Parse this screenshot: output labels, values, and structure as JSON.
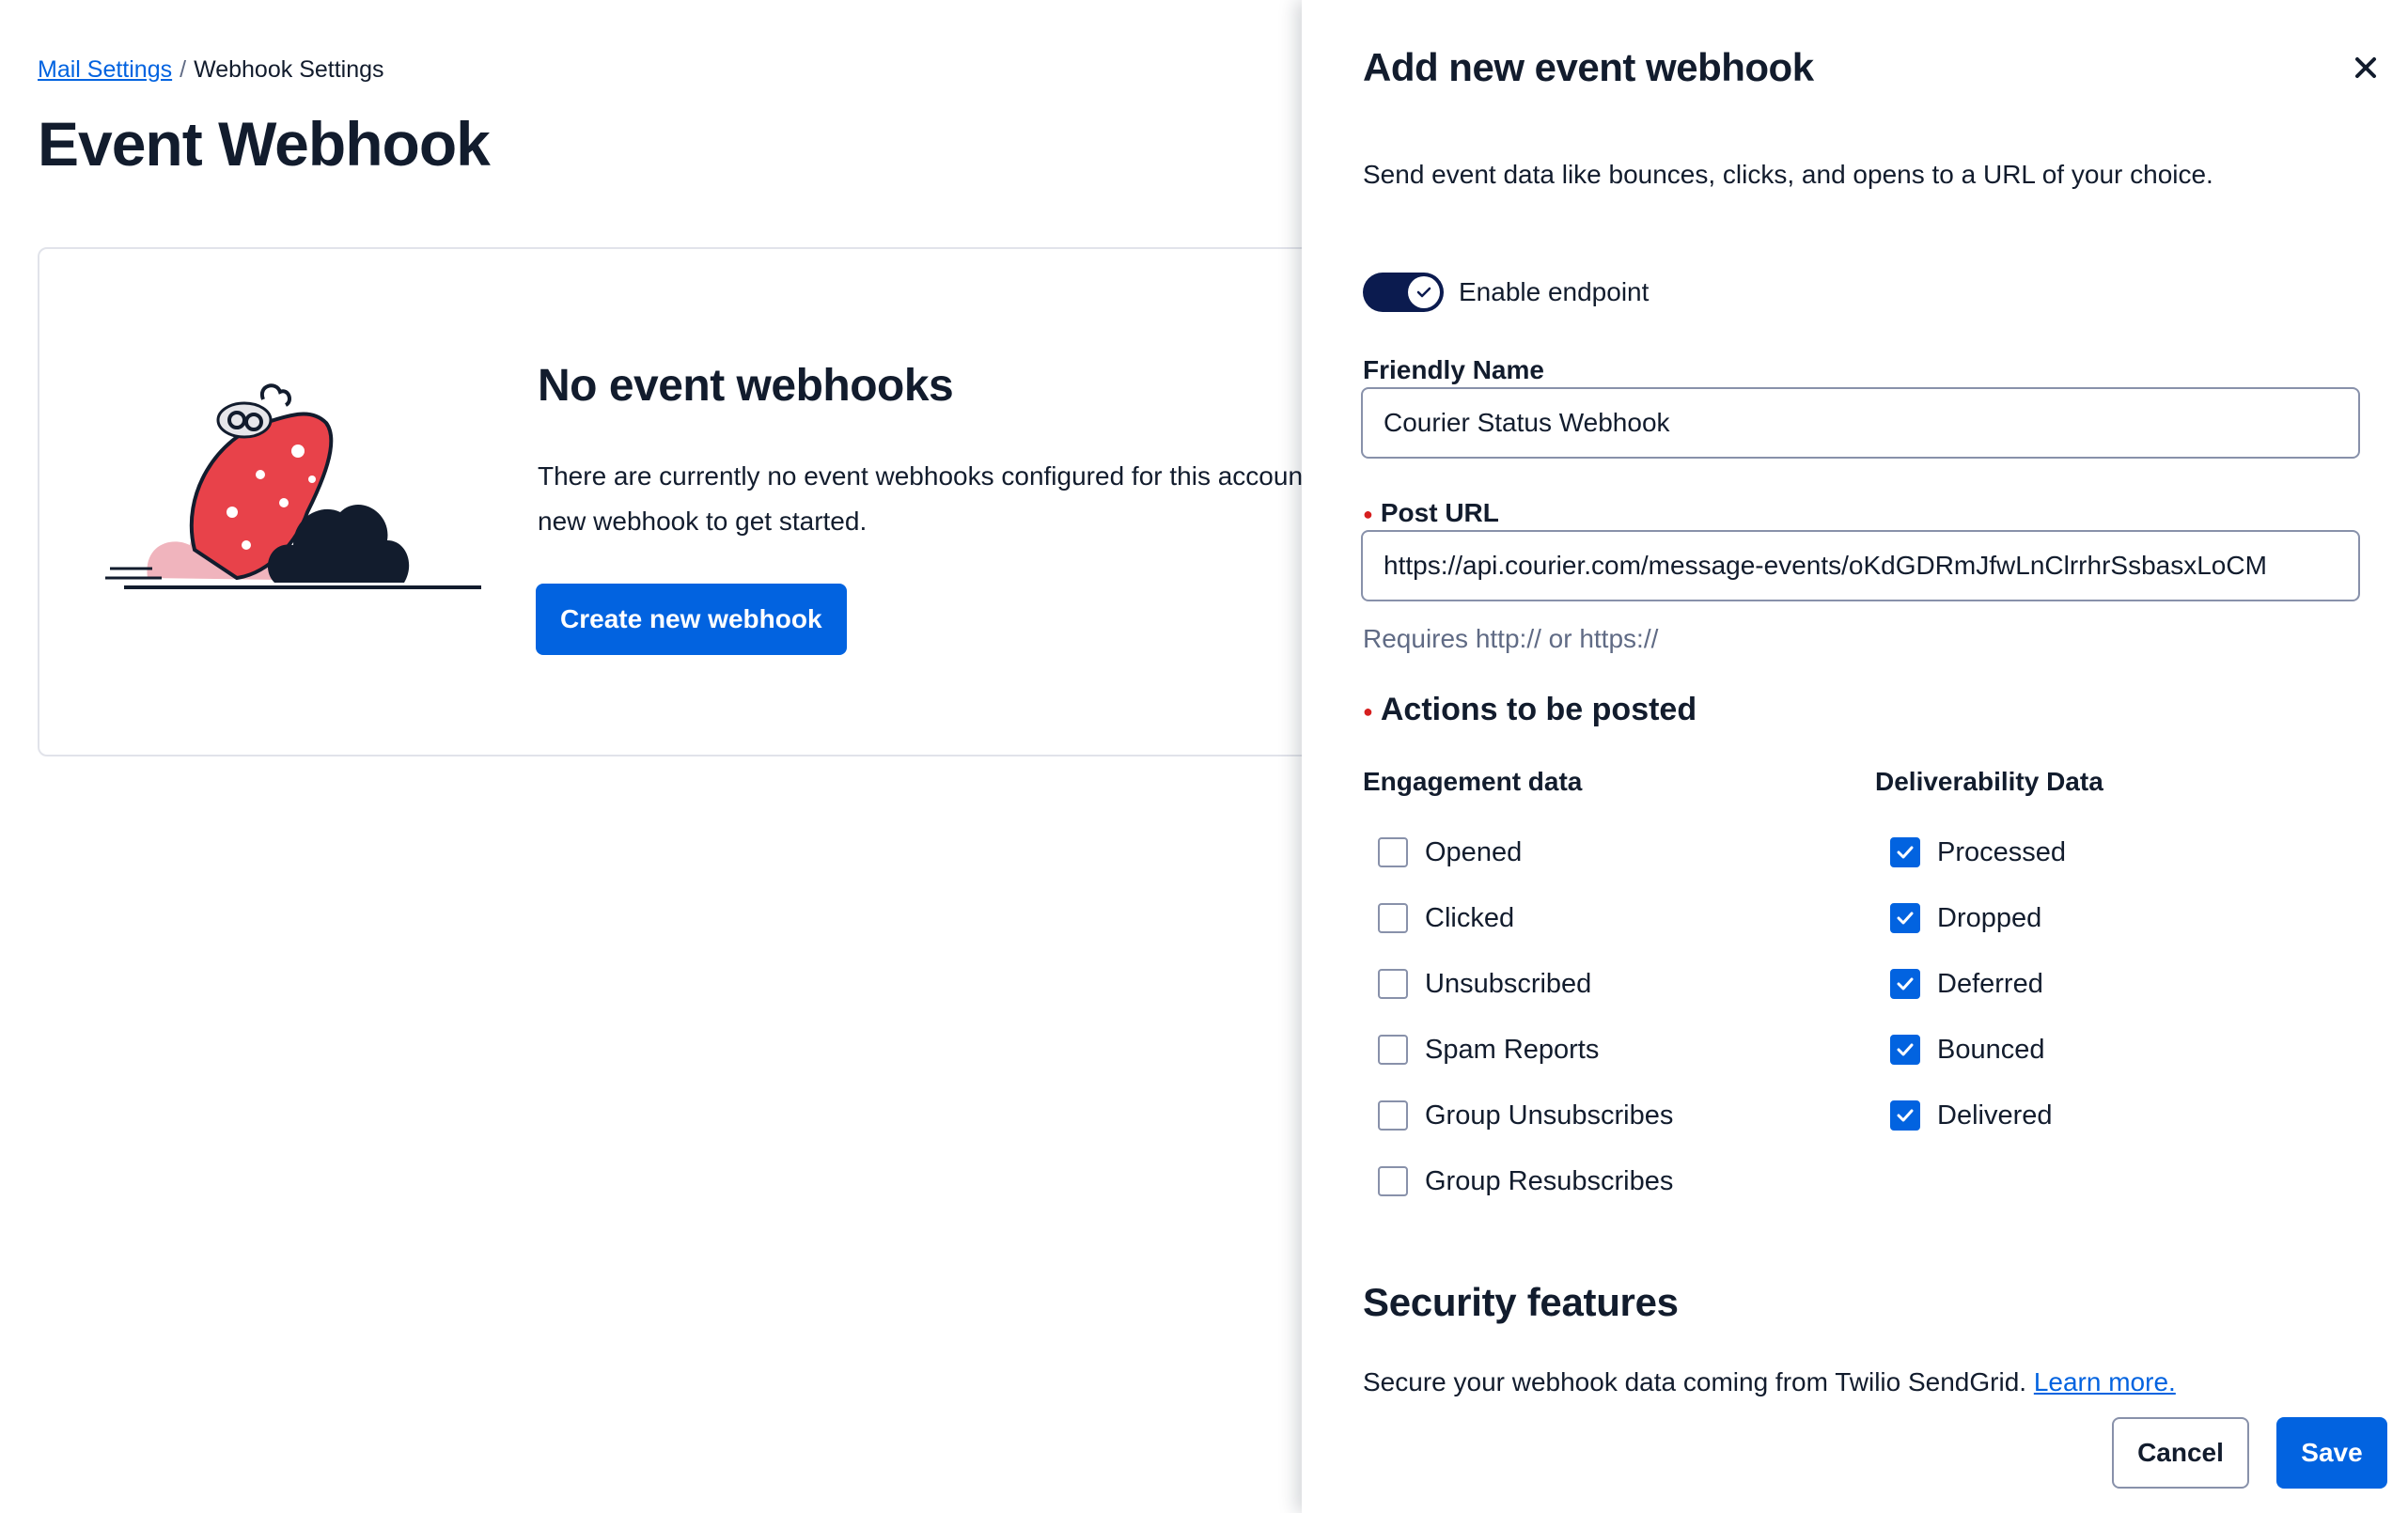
{
  "breadcrumb": {
    "parent_link": "Mail Settings",
    "separator": "/",
    "current": "Webhook Settings"
  },
  "page": {
    "title": "Event Webhook"
  },
  "empty_state": {
    "title": "No event webhooks",
    "text": "There are currently no event webhooks configured for this account. Create a new webhook to get started.",
    "button": "Create new webhook"
  },
  "drawer": {
    "title": "Add new event webhook",
    "description": "Send event data like bounces, clicks, and opens to a URL of your choice.",
    "toggle": {
      "label": "Enable endpoint",
      "enabled": true
    },
    "friendly_name": {
      "label": "Friendly Name",
      "value": "Courier Status Webhook"
    },
    "post_url": {
      "label": "Post URL",
      "value": "https://api.courier.com/message-events/oKdGDRmJfwLnClrrhrSsbasxLoCM",
      "help": "Requires http:// or https://"
    },
    "actions": {
      "label": "Actions to be posted",
      "engagement": {
        "heading": "Engagement data",
        "items": [
          {
            "label": "Opened",
            "checked": false
          },
          {
            "label": "Clicked",
            "checked": false
          },
          {
            "label": "Unsubscribed",
            "checked": false
          },
          {
            "label": "Spam Reports",
            "checked": false
          },
          {
            "label": "Group Unsubscribes",
            "checked": false
          },
          {
            "label": "Group Resubscribes",
            "checked": false
          }
        ]
      },
      "deliverability": {
        "heading": "Deliverability Data",
        "items": [
          {
            "label": "Processed",
            "checked": true
          },
          {
            "label": "Dropped",
            "checked": true
          },
          {
            "label": "Deferred",
            "checked": true
          },
          {
            "label": "Bounced",
            "checked": true
          },
          {
            "label": "Delivered",
            "checked": true
          }
        ]
      }
    },
    "security": {
      "heading": "Security features",
      "text": "Secure your webhook data coming from Twilio SendGrid.",
      "link": "Learn more."
    },
    "buttons": {
      "cancel": "Cancel",
      "save": "Save"
    }
  },
  "colors": {
    "primary": "#0263e0",
    "toggle_on": "#0b1b4f",
    "text": "#121c2d",
    "muted": "#606b85",
    "required": "#d61f1f",
    "illustration_red": "#e8424a",
    "illustration_pink": "#f0b4bd",
    "illustration_dark": "#121c2d"
  },
  "icons": {
    "close": "close-icon",
    "toggle_check": "check-icon",
    "checkbox_check": "check-icon"
  }
}
